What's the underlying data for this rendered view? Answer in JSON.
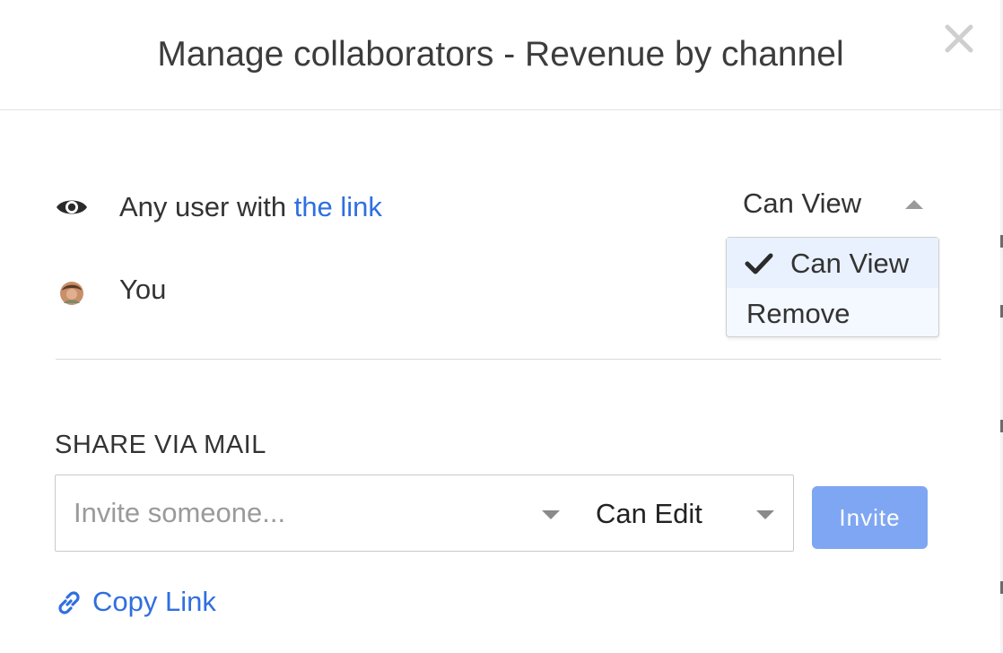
{
  "modal": {
    "title": "Manage collaborators - Revenue by channel"
  },
  "link_access": {
    "prefix": "Any user with ",
    "link_text": "the link",
    "permission": "Can View"
  },
  "permission_menu": {
    "options": [
      {
        "label": "Can View",
        "selected": true
      },
      {
        "label": "Remove",
        "selected": false
      }
    ]
  },
  "owner": {
    "name": "You"
  },
  "share_via_mail": {
    "heading": "SHARE VIA MAIL",
    "input_placeholder": "Invite someone...",
    "input_value": "",
    "role": "Can Edit",
    "invite_label": "Invite"
  },
  "copy_link": {
    "label": "Copy Link"
  },
  "icons": {
    "close": "close-icon",
    "eye": "eye-icon",
    "avatar": "avatar",
    "check": "check-icon",
    "link": "link-icon",
    "caret_up": "caret-up-icon",
    "caret_down": "caret-down-icon"
  },
  "colors": {
    "link": "#2f6fe0",
    "invite_button": "#7fa6f2",
    "dropdown_bg": "#f4f8ff",
    "selected_option_bg": "#e9f1fe"
  }
}
